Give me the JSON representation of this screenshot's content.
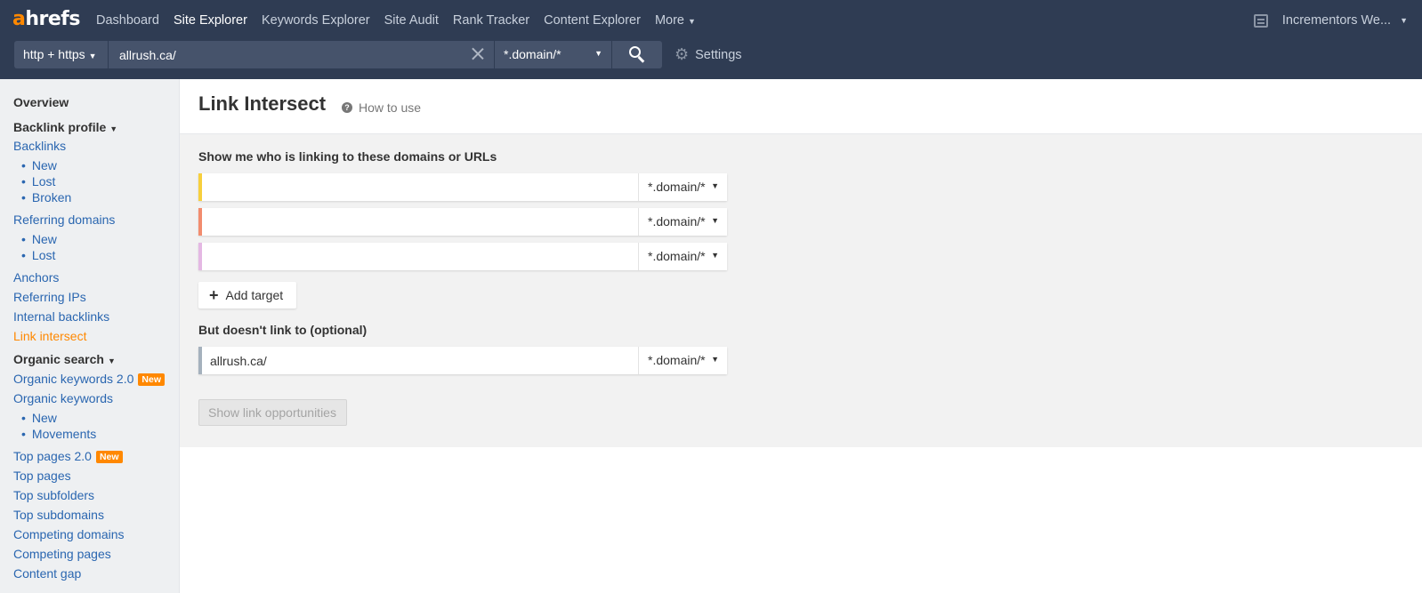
{
  "logo": {
    "accent": "a",
    "rest": "hrefs"
  },
  "nav": {
    "items": [
      {
        "label": "Dashboard",
        "active": false
      },
      {
        "label": "Site Explorer",
        "active": true
      },
      {
        "label": "Keywords Explorer",
        "active": false
      },
      {
        "label": "Site Audit",
        "active": false
      },
      {
        "label": "Rank Tracker",
        "active": false
      },
      {
        "label": "Content Explorer",
        "active": false
      },
      {
        "label": "More",
        "active": false
      }
    ],
    "account": "Incrementors We..."
  },
  "search": {
    "protocol": "http + https",
    "url_value": "allrush.ca/",
    "mode": "*.domain/*",
    "settings_label": "Settings"
  },
  "sidebar": {
    "overview": "Overview",
    "backlink_profile": "Backlink profile",
    "backlinks": "Backlinks",
    "backlinks_new": "New",
    "backlinks_lost": "Lost",
    "backlinks_broken": "Broken",
    "referring_domains": "Referring domains",
    "rd_new": "New",
    "rd_lost": "Lost",
    "anchors": "Anchors",
    "referring_ips": "Referring IPs",
    "internal_backlinks": "Internal backlinks",
    "link_intersect": "Link intersect",
    "organic_search": "Organic search",
    "organic_keywords_2": "Organic keywords 2.0",
    "organic_keywords": "Organic keywords",
    "ok_new": "New",
    "ok_movements": "Movements",
    "top_pages_2": "Top pages 2.0",
    "top_pages": "Top pages",
    "top_subfolders": "Top subfolders",
    "top_subdomains": "Top subdomains",
    "competing_domains": "Competing domains",
    "competing_pages": "Competing pages",
    "content_gap": "Content gap",
    "badge_new": "New"
  },
  "main": {
    "title": "Link Intersect",
    "how_to_use": "How to use",
    "linking_label": "Show me who is linking to these domains or URLs",
    "targets": [
      {
        "value": "",
        "mode": "*.domain/*",
        "color": "#f7cf3c"
      },
      {
        "value": "",
        "mode": "*.domain/*",
        "color": "#f28c6e"
      },
      {
        "value": "",
        "mode": "*.domain/*",
        "color": "#e4b8e3"
      }
    ],
    "add_target": "Add target",
    "exclude_label": "But doesn't link to (optional)",
    "exclude": {
      "value": "allrush.ca/",
      "mode": "*.domain/*",
      "color": "#a5b1bd"
    },
    "show_button": "Show link opportunities"
  },
  "colors": {
    "topbar": "#2f3c53",
    "brand_orange": "#ff8800",
    "link_blue": "#2a66b0"
  }
}
